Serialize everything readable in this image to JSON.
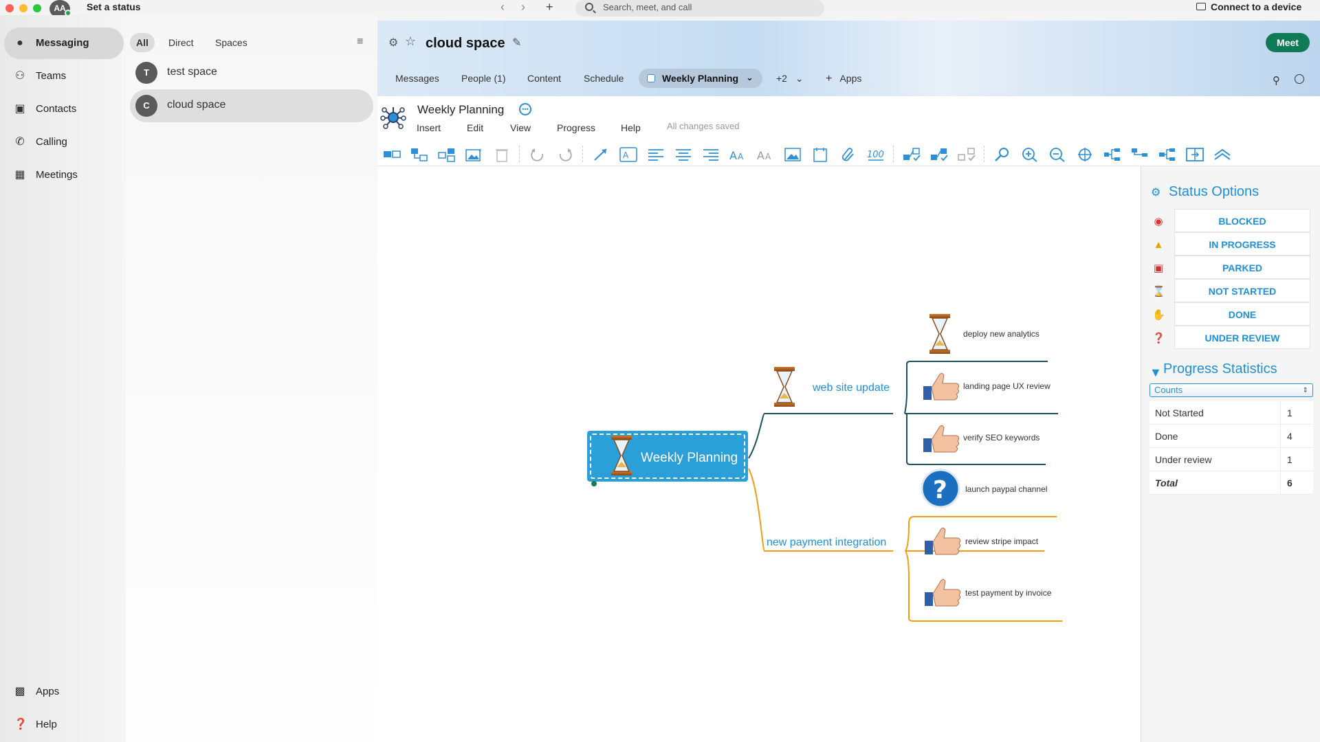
{
  "topbar": {
    "avatar_initials": "AA",
    "status_prompt": "Set a status",
    "search_placeholder": "Search, meet, and call",
    "connect_label": "Connect to a device"
  },
  "leftnav": {
    "items": [
      {
        "label": "Messaging",
        "icon": "chat-bubble-icon"
      },
      {
        "label": "Teams",
        "icon": "people-icon"
      },
      {
        "label": "Contacts",
        "icon": "contacts-icon"
      },
      {
        "label": "Calling",
        "icon": "phone-icon"
      },
      {
        "label": "Meetings",
        "icon": "calendar-icon"
      }
    ],
    "bottom": [
      {
        "label": "Apps",
        "icon": "apps-icon"
      },
      {
        "label": "Help",
        "icon": "help-icon"
      }
    ]
  },
  "spacelist": {
    "filters": [
      "All",
      "Direct",
      "Spaces"
    ],
    "spaces": [
      {
        "initial": "T",
        "name": "test space"
      },
      {
        "initial": "C",
        "name": "cloud space"
      }
    ]
  },
  "header": {
    "title": "cloud space",
    "meet_label": "Meet",
    "tabs": [
      "Messages",
      "People (1)",
      "Content",
      "Schedule",
      "Weekly Planning",
      "+2",
      "Apps"
    ]
  },
  "app": {
    "doc_title": "Weekly Planning",
    "menus": [
      "Insert",
      "Edit",
      "View",
      "Progress",
      "Help"
    ],
    "saved_status": "All changes saved"
  },
  "mindmap": {
    "root": "Weekly Planning",
    "branches": [
      {
        "label": "web site update",
        "color": "#1a4f5e",
        "children": [
          "deploy new analytics",
          "landing page UX review",
          "verify SEO keywords"
        ]
      },
      {
        "label": "new payment integration",
        "color": "#f39c12",
        "children": [
          "launch paypal channel",
          "review stripe impact",
          "test payment by invoice"
        ]
      }
    ]
  },
  "status_panel": {
    "title": "Status Options",
    "options": [
      {
        "label": "BLOCKED",
        "icon": "blocked-icon"
      },
      {
        "label": "IN PROGRESS",
        "icon": "warning-icon"
      },
      {
        "label": "PARKED",
        "icon": "parked-icon"
      },
      {
        "label": "NOT STARTED",
        "icon": "not-started-icon"
      },
      {
        "label": "DONE",
        "icon": "thumbs-up-icon"
      },
      {
        "label": "UNDER REVIEW",
        "icon": "question-icon"
      }
    ],
    "progress_title": "Progress Statistics",
    "counts_select": "Counts",
    "stats": [
      {
        "label": "Not Started",
        "value": "1"
      },
      {
        "label": "Done",
        "value": "4"
      },
      {
        "label": "Under review",
        "value": "1"
      },
      {
        "label": "Total",
        "value": "6"
      }
    ]
  },
  "colors": {
    "accent": "#1f8fd6",
    "meet_green": "#0f7a56",
    "branch_dark": "#1a4f5e",
    "branch_orange": "#f39c12"
  }
}
